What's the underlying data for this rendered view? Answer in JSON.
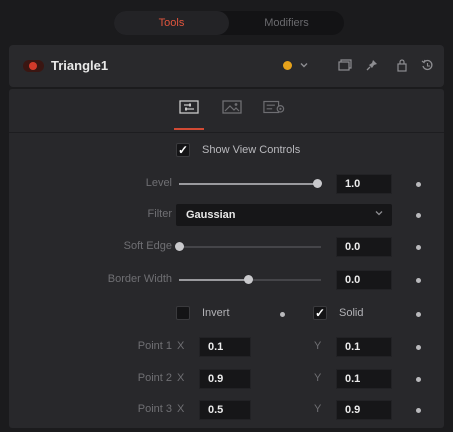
{
  "tabs": {
    "active": "Tools",
    "inactive": "Modifiers"
  },
  "header": {
    "node_name": "Triangle1",
    "accent_color": "#e6a21b"
  },
  "panel": {
    "show_view_controls": {
      "label": "Show View Controls",
      "checked": true
    },
    "level": {
      "label": "Level",
      "value": "1.0",
      "slider_fraction": 1.0
    },
    "filter": {
      "label": "Filter",
      "value": "Gaussian"
    },
    "soft_edge": {
      "label": "Soft Edge",
      "value": "0.0",
      "slider_fraction": 0.0
    },
    "border_width": {
      "label": "Border Width",
      "value": "0.0",
      "slider_fraction": 0.5
    },
    "invert": {
      "label": "Invert",
      "checked": false
    },
    "solid": {
      "label": "Solid",
      "checked": true
    },
    "points": [
      {
        "label": "Point 1",
        "x_axis": "X",
        "x": "0.1",
        "y_axis": "Y",
        "y": "0.1"
      },
      {
        "label": "Point 2",
        "x_axis": "X",
        "x": "0.9",
        "y_axis": "Y",
        "y": "0.1"
      },
      {
        "label": "Point 3",
        "x_axis": "X",
        "x": "0.5",
        "y_axis": "Y",
        "y": "0.9"
      }
    ]
  },
  "icons": {
    "header": [
      "node-color-icon",
      "chevron-down-icon",
      "view-icon",
      "pin-icon",
      "lock-icon",
      "reset-icon"
    ],
    "panel_tabs": [
      "controls-tab-icon",
      "image-tab-icon",
      "settings-tab-icon"
    ]
  }
}
